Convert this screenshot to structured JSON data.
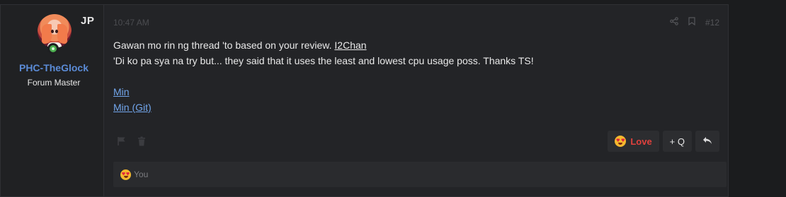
{
  "user": {
    "initials": "JP",
    "username": "PHC-TheGlock",
    "title": "Forum Master"
  },
  "post": {
    "time": "10:47 AM",
    "number": "#12",
    "line1_text": "Gawan mo rin ng thread 'to based on your review. ",
    "line1_link": "I2Chan",
    "line2": "'Di ko pa sya na try but... they said that it uses the least and lowest cpu usage poss. Thanks TS!",
    "link1": "Min",
    "link2": "Min (Git)"
  },
  "actions": {
    "love_label": "Love",
    "quote_label": "+ Q",
    "reply_icon": "reply-icon"
  },
  "reactions": {
    "text": "You"
  },
  "colors": {
    "background": "#1b1c1e",
    "post_bg": "#232427",
    "username": "#5b8bd6",
    "link": "#72a6ec",
    "love": "#e0413d"
  }
}
